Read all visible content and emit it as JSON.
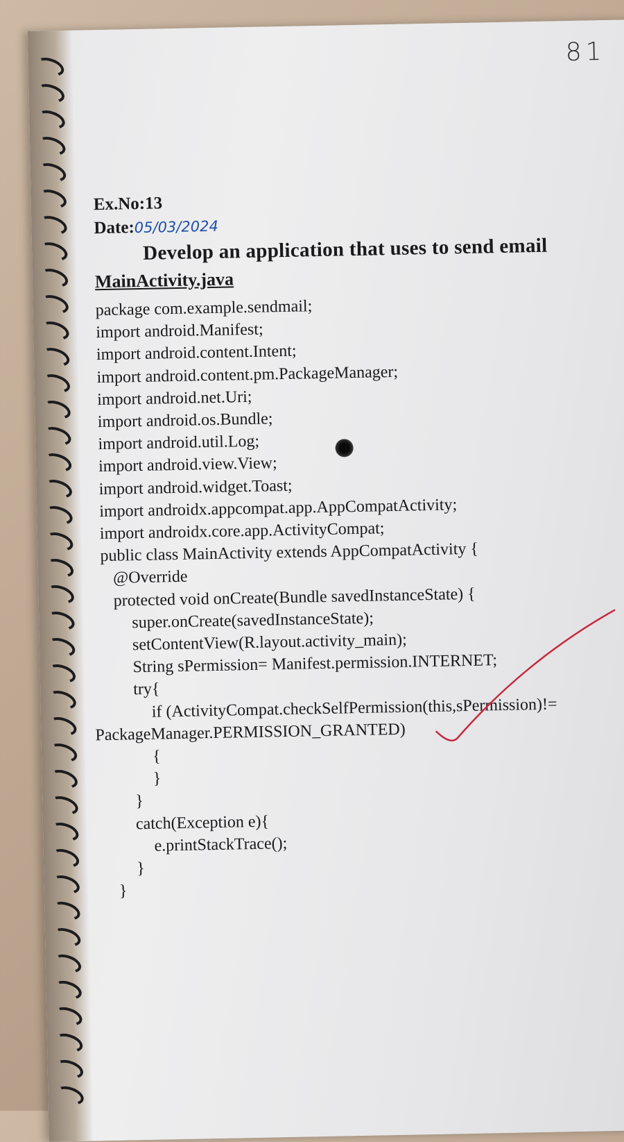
{
  "page_number": "81",
  "header": {
    "ex_no": "Ex.No:13",
    "date_label": "Date:",
    "date_value": "05/03/2024"
  },
  "title": "Develop an application that uses to send email",
  "file_name": "MainActivity.java",
  "code_lines": [
    "package com.example.sendmail;",
    "import android.Manifest;",
    "import android.content.Intent;",
    "import android.content.pm.PackageManager;",
    "import android.net.Uri;",
    "import android.os.Bundle;",
    "import android.util.Log;",
    "import android.view.View;",
    "import android.widget.Toast;",
    "import androidx.appcompat.app.AppCompatActivity;",
    "import androidx.core.app.ActivityCompat;",
    "public class MainActivity extends AppCompatActivity {",
    "@Override",
    "protected void onCreate(Bundle savedInstanceState) {",
    "super.onCreate(savedInstanceState);",
    "setContentView(R.layout.activity_main);",
    "String sPermission= Manifest.permission.INTERNET;",
    "try{",
    "if (ActivityCompat.checkSelfPermission(this,sPermission)!=",
    "PackageManager.PERMISSION_GRANTED)",
    "{",
    "}",
    "}",
    "catch(Exception e){",
    "e.printStackTrace();",
    "}",
    "}"
  ]
}
